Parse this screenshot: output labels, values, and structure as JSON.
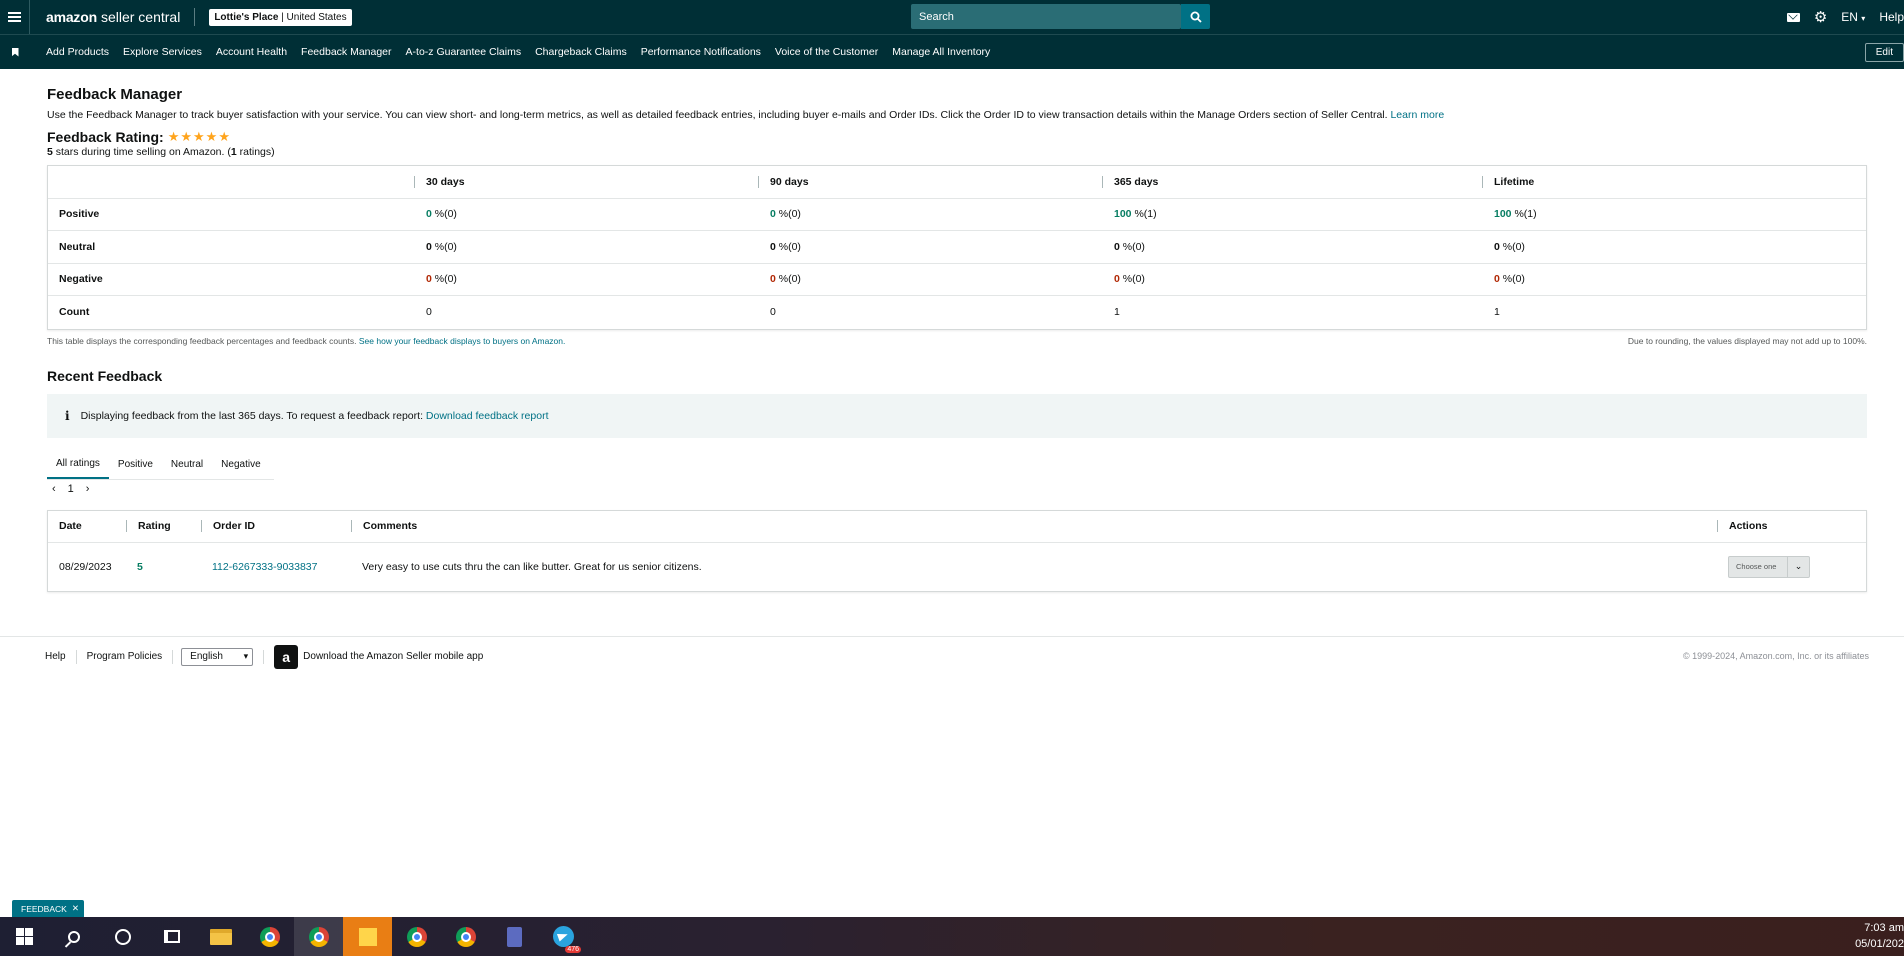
{
  "topbar": {
    "logo_brand": "amazon",
    "logo_product": "seller central",
    "store_name": "Lottie's Place",
    "store_marketplace": "United States",
    "search_placeholder": "Search",
    "language": "EN",
    "help": "Help"
  },
  "nav": {
    "items": [
      "Add Products",
      "Explore Services",
      "Account Health",
      "Feedback Manager",
      "A-to-z Guarantee Claims",
      "Chargeback Claims",
      "Performance Notifications",
      "Voice of the Customer",
      "Manage All Inventory"
    ],
    "edit": "Edit"
  },
  "page": {
    "title": "Feedback Manager",
    "description": "Use the Feedback Manager to track buyer satisfaction with your service. You can view short- and long-term metrics, as well as detailed feedback entries, including buyer e-mails and Order IDs. Click the Order ID to view transaction details within the Manage Orders section of Seller Central.",
    "learn_more": "Learn more",
    "rating_label": "Feedback Rating:",
    "rating_stars": 5,
    "rating_sub_stars": "5",
    "rating_sub_text": " stars during time selling on Amazon. (",
    "rating_sub_count": "1",
    "rating_sub_end": " ratings)"
  },
  "metrics": {
    "headers": [
      "30 days",
      "90 days",
      "365 days",
      "Lifetime"
    ],
    "rows": {
      "positive": {
        "label": "Positive",
        "cells": [
          [
            "0",
            " %(0)"
          ],
          [
            "0",
            " %(0)"
          ],
          [
            "100",
            " %(1)"
          ],
          [
            "100",
            " %(1)"
          ]
        ]
      },
      "neutral": {
        "label": "Neutral",
        "cells": [
          [
            "0",
            " %(0)"
          ],
          [
            "0",
            " %(0)"
          ],
          [
            "0",
            " %(0)"
          ],
          [
            "0",
            " %(0)"
          ]
        ]
      },
      "negative": {
        "label": "Negative",
        "cells": [
          [
            "0",
            " %(0)"
          ],
          [
            "0",
            " %(0)"
          ],
          [
            "0",
            " %(0)"
          ],
          [
            "0",
            " %(0)"
          ]
        ]
      },
      "count": {
        "label": "Count",
        "cells": [
          "0",
          "0",
          "1",
          "1"
        ]
      }
    },
    "note_left": "This table displays the corresponding feedback percentages and feedback counts.",
    "note_left_link": "See how your feedback displays to buyers on Amazon.",
    "note_right": "Due to rounding, the values displayed may not add up to 100%."
  },
  "recent": {
    "title": "Recent Feedback",
    "alert_icon": "info-icon",
    "alert_text": "Displaying feedback from the last 365 days. To request a feedback report:",
    "alert_link": "Download feedback report",
    "tabs": [
      "All ratings",
      "Positive",
      "Neutral",
      "Negative"
    ],
    "page": "1",
    "table": {
      "headers": [
        "Date",
        "Rating",
        "Order ID",
        "Comments",
        "Actions"
      ],
      "rows": [
        {
          "date": "08/29/2023",
          "rating": "5",
          "order_id": "112-6267333-9033837",
          "comment": "Very easy to use cuts thru the can like butter. Great for us senior citizens.",
          "action": "Choose one"
        }
      ]
    }
  },
  "footer": {
    "help": "Help",
    "policies": "Program Policies",
    "language": "English",
    "app_text": "Download the Amazon Seller mobile app",
    "copyright": "© 1999-2024, Amazon.com, Inc. or its affiliates"
  },
  "feedback_chip": "FEEDBACK",
  "taskbar": {
    "telegram_badge": "476",
    "time": "7:03 am",
    "date": "05/01/202"
  },
  "colors": {
    "header_bg": "#002f36",
    "link": "#007185",
    "positive": "#067d62",
    "negative": "#b12704",
    "star": "#ffa41c"
  }
}
